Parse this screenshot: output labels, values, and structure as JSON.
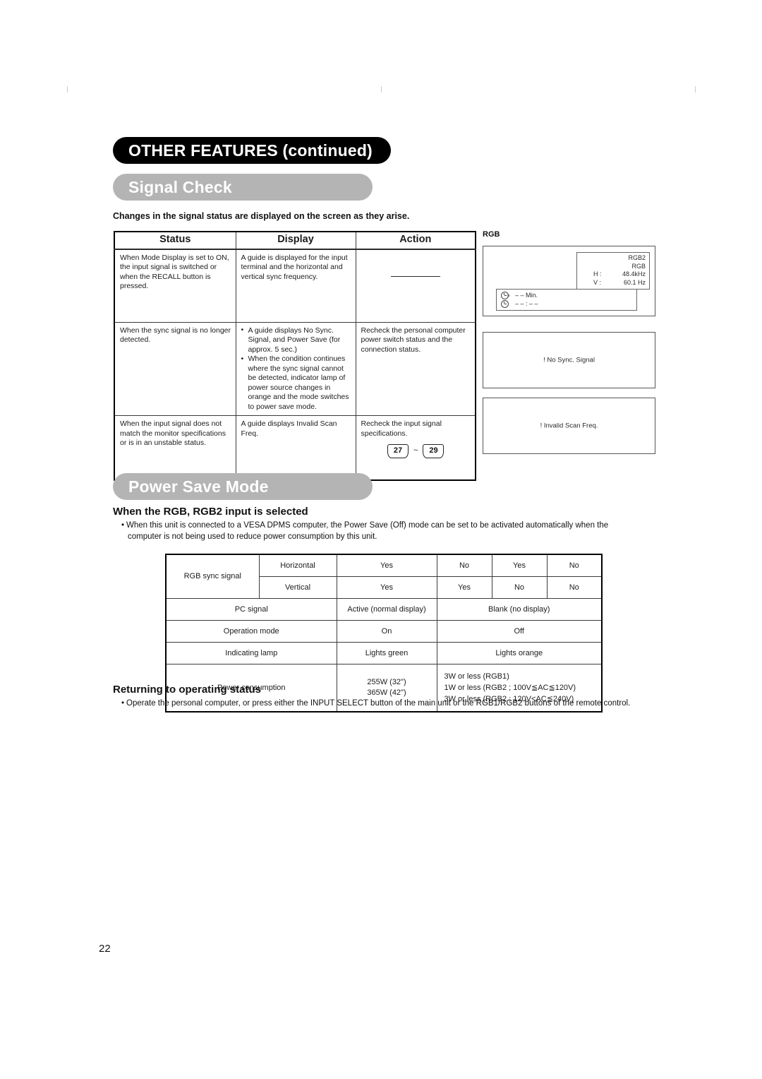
{
  "page": {
    "chapter_title": "OTHER FEATURES (continued)",
    "page_number": "22"
  },
  "signal_check": {
    "pill_label": "Signal Check",
    "intro": "Changes in the signal status are displayed on the screen as they arise.",
    "table": {
      "headers": [
        "Status",
        "Display",
        "Action"
      ],
      "rows": [
        {
          "status": "When Mode Display is set to ON, the input signal is switched or when the RECALL button is pressed.",
          "display": "A guide is displayed for the input terminal and the horizontal and vertical sync frequency.",
          "action": ""
        },
        {
          "status": "When the sync signal is no longer detected.",
          "display_bullets": [
            "A guide displays No Sync. Signal, and Power Save (for approx. 5 sec.)",
            "When the condition continues where the sync signal cannot be detected, indicator lamp of power source changes in orange and the mode switches to power save mode."
          ],
          "action": "Recheck the personal computer power switch status and the connection status."
        },
        {
          "status": "When the input signal does not match the monitor specifications or is in an unstable status.",
          "display": "A guide displays Invalid Scan Freq.",
          "action": "Recheck the input signal specifications.",
          "page_ref_from": "27",
          "page_ref_tilde": "~",
          "page_ref_to": "29"
        }
      ]
    },
    "osd": {
      "label": "RGB",
      "info_panel": {
        "line1": "RGB2",
        "line2": "RGB",
        "h_key": "H :",
        "h_value": "48.4kHz",
        "v_key": "V :",
        "v_value": "60.1 Hz"
      },
      "timer_panel": {
        "row1_value": "– – Min.",
        "row2_value": "– – : – –"
      },
      "message_no_sync": "! No Sync. Signal",
      "message_invalid_scan": "! Invalid Scan Freq."
    }
  },
  "power_save": {
    "pill_label": "Power Save Mode",
    "sub_heading": "When the RGB, RGB2 input is selected",
    "bullet_line1": "When this unit is connected to a VESA DPMS computer, the Power Save (Off) mode can be set to be activated automatically when the",
    "bullet_line2": "computer is not being used to reduce power consumption by this unit.",
    "table": {
      "row_sync_label": "RGB sync signal",
      "row_horizontal_label": "Horizontal",
      "row_horizontal": [
        "Yes",
        "No",
        "Yes",
        "No"
      ],
      "row_vertical_label": "Vertical",
      "row_vertical": [
        "Yes",
        "Yes",
        "No",
        "No"
      ],
      "row_pc_label": "PC signal",
      "row_pc_active": "Active (normal display)",
      "row_pc_blank": "Blank (no display)",
      "row_opmode_label": "Operation mode",
      "row_opmode_on": "On",
      "row_opmode_off": "Off",
      "row_lamp_label": "Indicating lamp",
      "row_lamp_on": "Lights green",
      "row_lamp_off": "Lights orange",
      "row_power_label": "Power consumption",
      "row_power_on_1": "255W (32\")",
      "row_power_on_2": "365W (42\")",
      "row_power_off_1": "3W or less (RGB1)",
      "row_power_off_2": "1W or less (RGB2 ; 100V≦AC≦120V)",
      "row_power_off_3": "3W or less (RGB2 ; 120V<AC≦240V)"
    }
  },
  "returning": {
    "sub_heading": "Returning to operating status",
    "bullet": "Operate the personal computer, or press either the INPUT SELECT button of the main unit or the RGB1/RGB2 buttons of the remote control."
  },
  "colors": {
    "chapter_pill_bg": "#000000",
    "section_pill_bg": "#b4b4b4",
    "text": "#1a1a1a",
    "rule": "#3a3a3a"
  }
}
